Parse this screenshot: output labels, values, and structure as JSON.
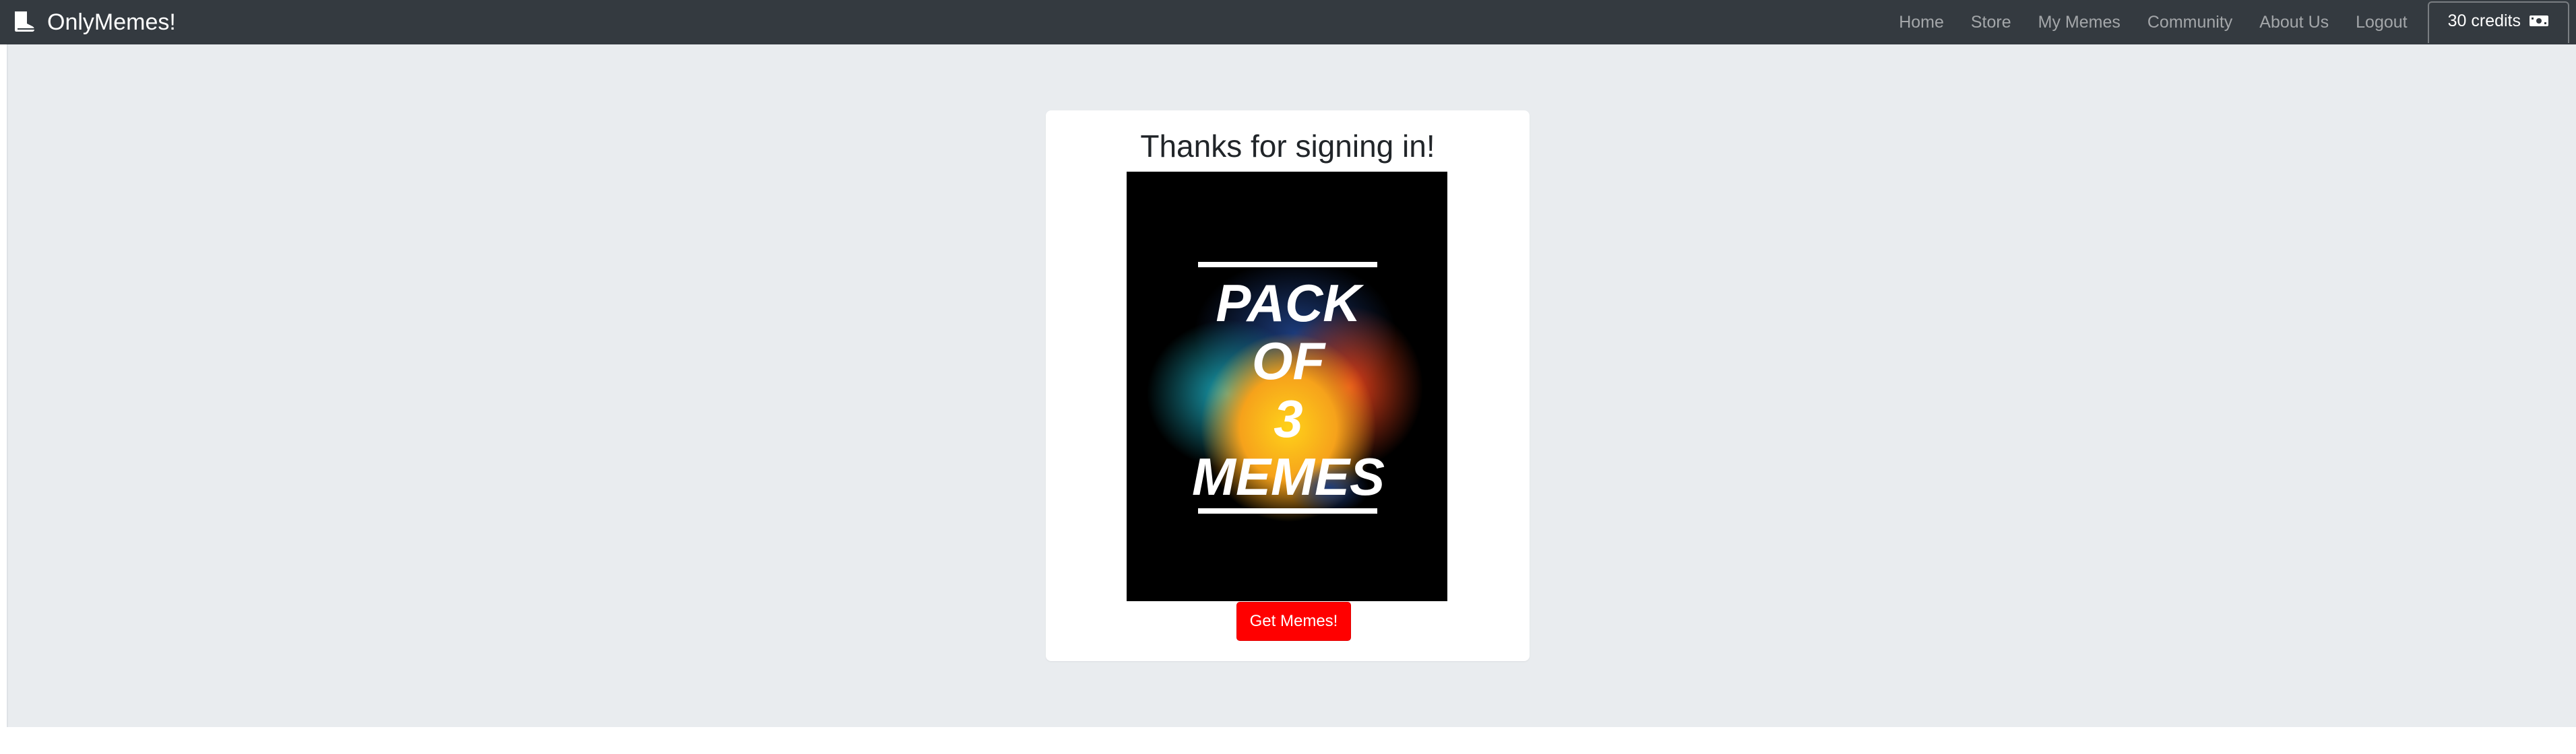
{
  "navbar": {
    "brand": "OnlyMemes!",
    "brand_icon": "boot-icon",
    "links": [
      "Home",
      "Store",
      "My Memes",
      "Community",
      "About Us",
      "Logout"
    ],
    "credits_label": "30 credits",
    "credits_icon": "cash-icon"
  },
  "card": {
    "title": "Thanks for signing in!",
    "image_text": [
      "PACK",
      "OF",
      "3",
      "MEMES"
    ],
    "button_label": "Get Memes!"
  },
  "colors": {
    "navbar_bg": "#343a40",
    "page_bg": "#e9ecef",
    "button_bg": "#ff0000"
  }
}
